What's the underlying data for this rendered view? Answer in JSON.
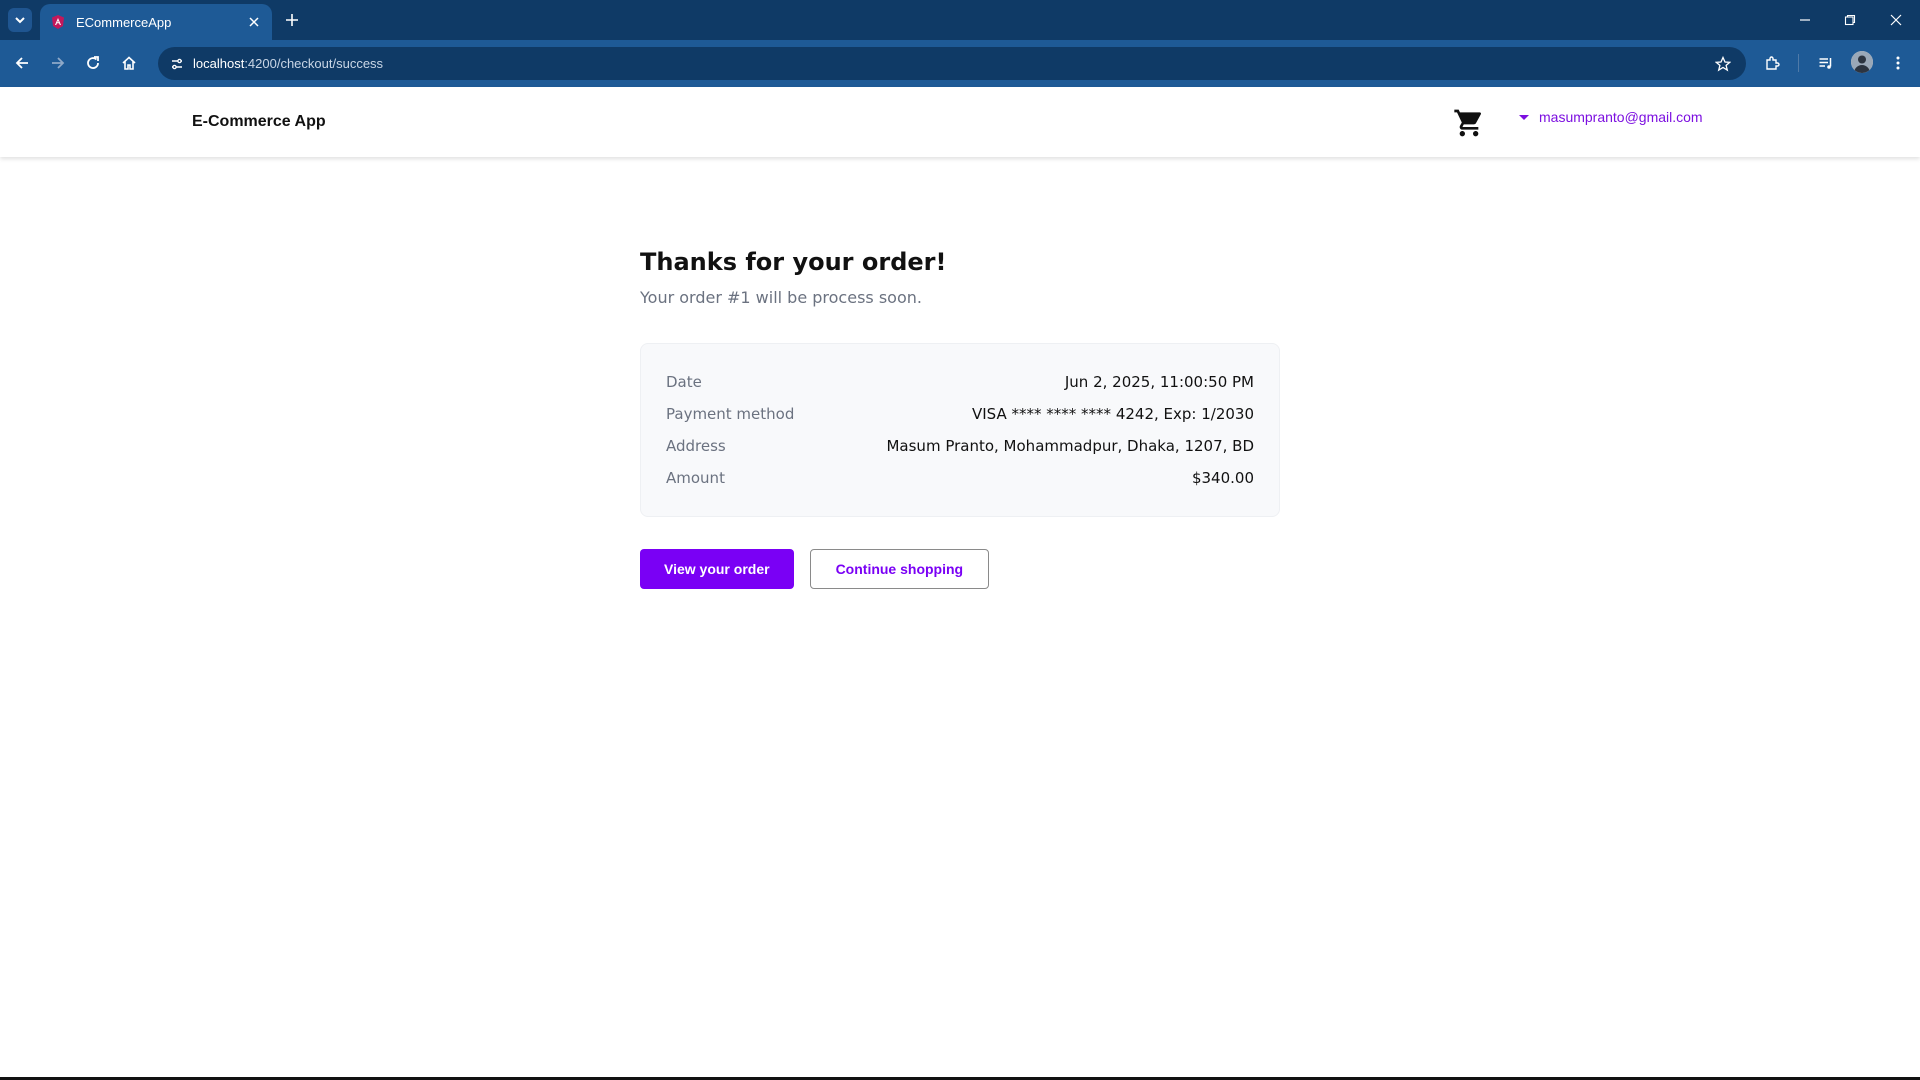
{
  "browser": {
    "tab_title": "ECommerceApp",
    "url_host": "localhost",
    "url_path": ":4200/checkout/success"
  },
  "app": {
    "brand": "E-Commerce App",
    "user_email": "masumpranto@gmail.com"
  },
  "order": {
    "title": "Thanks for your order!",
    "subtitle": "Your order #1 will be process soon.",
    "details": [
      {
        "label": "Date",
        "value": "Jun 2, 2025, 11:00:50 PM"
      },
      {
        "label": "Payment method",
        "value": "VISA **** **** **** 4242, Exp: 1/2030"
      },
      {
        "label": "Address",
        "value": "Masum Pranto, Mohammadpur, Dhaka, 1207, BD"
      },
      {
        "label": "Amount",
        "value": "$340.00"
      }
    ]
  },
  "actions": {
    "view_order": "View your order",
    "continue_shopping": "Continue shopping"
  },
  "colors": {
    "accent": "#7a00f5",
    "chrome_dark": "#0f3a66",
    "chrome_toolbar": "#1e5a96"
  }
}
